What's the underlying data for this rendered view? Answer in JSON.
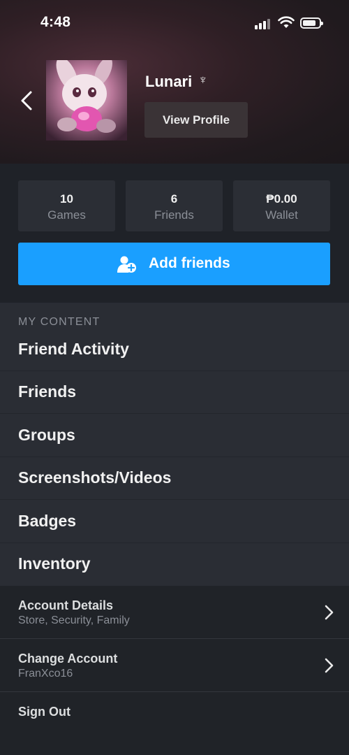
{
  "status_bar": {
    "time": "4:48"
  },
  "profile": {
    "username": "Lunari",
    "username_icon": "♆",
    "view_profile_label": "View Profile",
    "avatar_icon": "avatar-image"
  },
  "stats": [
    {
      "value": "10",
      "label": "Games"
    },
    {
      "value": "6",
      "label": "Friends"
    },
    {
      "value": "₱0.00",
      "label": "Wallet"
    }
  ],
  "add_friends": {
    "label": "Add friends",
    "icon": "add-user-icon",
    "color": "#1a9fff"
  },
  "my_content": {
    "heading": "MY CONTENT",
    "items": [
      {
        "label": "Friend Activity"
      },
      {
        "label": "Friends"
      },
      {
        "label": "Groups"
      },
      {
        "label": "Screenshots/Videos"
      },
      {
        "label": "Badges"
      },
      {
        "label": "Inventory"
      }
    ]
  },
  "account": {
    "details": {
      "title": "Account Details",
      "subtitle": "Store, Security, Family"
    },
    "change": {
      "title": "Change Account",
      "subtitle": "FranXco16"
    },
    "sign_out_label": "Sign Out"
  },
  "colors": {
    "accent": "#1a9fff",
    "background": "#1b1d22",
    "panel": "#2a2d34"
  }
}
